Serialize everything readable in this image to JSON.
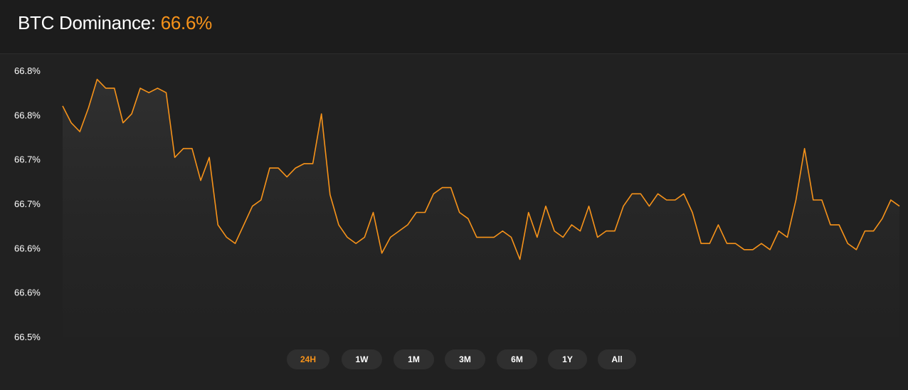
{
  "header": {
    "title_label": "BTC Dominance:",
    "title_value": "66.6%"
  },
  "colors": {
    "accent": "#f7931a",
    "background": "#212121",
    "header_background": "#1c1c1c",
    "button_background": "#2f2f2f"
  },
  "chart_data": {
    "type": "area",
    "title": "BTC Dominance",
    "xlabel": "",
    "ylabel": "",
    "y_tick_labels": [
      "66.8%",
      "66.8%",
      "66.7%",
      "66.7%",
      "66.6%",
      "66.6%",
      "66.5%"
    ],
    "ylim": [
      66.5,
      66.8
    ],
    "grid": false,
    "series": [
      {
        "name": "",
        "color": "#f7931a",
        "values": [
          66.76,
          66.741,
          66.731,
          66.758,
          66.79,
          66.78,
          66.78,
          66.741,
          66.751,
          66.78,
          66.775,
          66.78,
          66.775,
          66.702,
          66.712,
          66.712,
          66.676,
          66.702,
          66.626,
          66.612,
          66.605,
          66.626,
          66.647,
          66.654,
          66.69,
          66.69,
          66.68,
          66.69,
          66.695,
          66.695,
          66.751,
          66.66,
          66.626,
          66.612,
          66.605,
          66.612,
          66.64,
          66.594,
          66.612,
          66.619,
          66.626,
          66.64,
          66.64,
          66.661,
          66.668,
          66.668,
          66.64,
          66.633,
          66.612,
          66.612,
          66.612,
          66.619,
          66.612,
          66.587,
          66.64,
          66.612,
          66.647,
          66.619,
          66.612,
          66.626,
          66.619,
          66.647,
          66.612,
          66.619,
          66.619,
          66.647,
          66.661,
          66.661,
          66.647,
          66.661,
          66.654,
          66.654,
          66.661,
          66.64,
          66.605,
          66.605,
          66.626,
          66.605,
          66.605,
          66.598,
          66.598,
          66.605,
          66.598,
          66.619,
          66.612,
          66.654,
          66.712,
          66.654,
          66.654,
          66.626,
          66.626,
          66.605,
          66.598,
          66.619,
          66.619,
          66.633,
          66.654,
          66.647
        ]
      }
    ]
  },
  "time_ranges": [
    {
      "label": "24H",
      "active": true
    },
    {
      "label": "1W",
      "active": false
    },
    {
      "label": "1M",
      "active": false
    },
    {
      "label": "3M",
      "active": false
    },
    {
      "label": "6M",
      "active": false
    },
    {
      "label": "1Y",
      "active": false
    },
    {
      "label": "All",
      "active": false
    }
  ]
}
